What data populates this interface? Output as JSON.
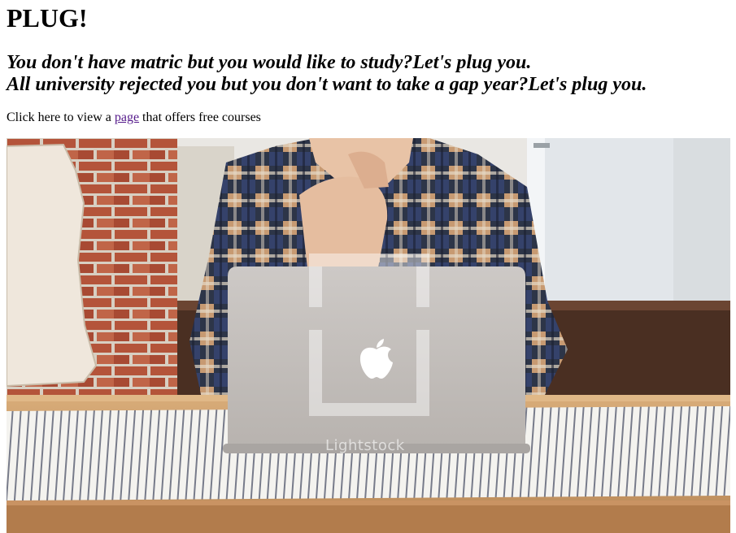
{
  "page": {
    "title": "PLUG!",
    "subtitle_lines": [
      "You don't have matric but you would like to study?Let's plug you.",
      "All university rejected you but you don't want to take a gap year?Let's plug you."
    ],
    "intro": {
      "before": "Click here to view a ",
      "link_text": "page",
      "after": " that offers free courses"
    },
    "hero_image": {
      "watermark": "Lightstock",
      "logo_icon": "apple-logo-icon"
    }
  },
  "colors": {
    "link": "#551a8b",
    "text": "#000000",
    "background": "#ffffff"
  }
}
